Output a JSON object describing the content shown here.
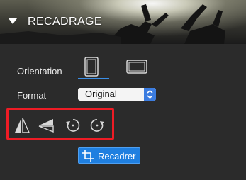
{
  "header": {
    "title": "RECADRAGE",
    "collapse_icon": "triangle-down-icon"
  },
  "orientation": {
    "label": "Orientation",
    "options": [
      {
        "name": "portrait",
        "icon": "portrait-frame-icon",
        "selected": true
      },
      {
        "name": "landscape",
        "icon": "landscape-frame-icon",
        "selected": false
      }
    ]
  },
  "format": {
    "label": "Format",
    "selected": "Original"
  },
  "tools": [
    {
      "name": "flip-horizontal",
      "icon": "flip-horizontal-icon"
    },
    {
      "name": "flip-vertical",
      "icon": "flip-vertical-icon"
    },
    {
      "name": "rotate-left",
      "icon": "rotate-left-icon"
    },
    {
      "name": "rotate-right",
      "icon": "rotate-right-icon"
    }
  ],
  "crop": {
    "label": "Recadrer",
    "icon": "crop-icon"
  },
  "colors": {
    "accent": "#1f7fe0",
    "highlight": "#ee1c25",
    "panel_bg": "#2b2b2b"
  }
}
